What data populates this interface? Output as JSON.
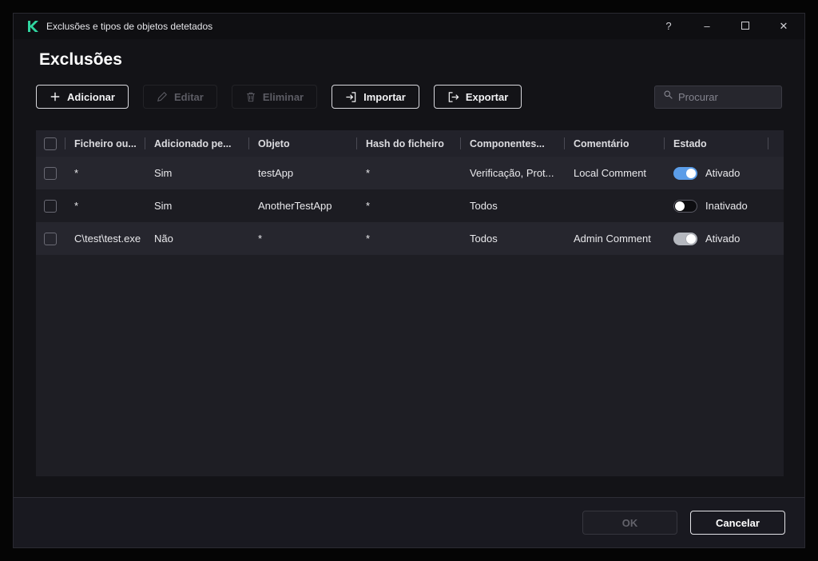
{
  "window": {
    "title": "Exclusões e tipos de objetos detetados",
    "help_glyph": "?",
    "minimize_glyph": "–",
    "close_glyph": "✕"
  },
  "page": {
    "title": "Exclusões"
  },
  "toolbar": {
    "add": "Adicionar",
    "edit": "Editar",
    "delete": "Eliminar",
    "import": "Importar",
    "export": "Exportar",
    "search_placeholder": "Procurar"
  },
  "table": {
    "headers": {
      "file": "Ficheiro ou...",
      "added": "Adicionado pe...",
      "object": "Objeto",
      "hash": "Hash do ficheiro",
      "components": "Componentes...",
      "comment": "Comentário",
      "state": "Estado"
    },
    "rows": [
      {
        "file": "*",
        "added": "Sim",
        "object": "testApp",
        "hash": "*",
        "components": "Verificação, Prot...",
        "comment": "Local Comment",
        "state_label": "Ativado",
        "toggle": "on"
      },
      {
        "file": "*",
        "added": "Sim",
        "object": "AnotherTestApp",
        "hash": "*",
        "components": "Todos",
        "comment": "",
        "state_label": "Inativado",
        "toggle": "off"
      },
      {
        "file": "C\\test\\test.exe",
        "added": "Não",
        "object": "*",
        "hash": "*",
        "components": "Todos",
        "comment": "Admin Comment",
        "state_label": "Ativado",
        "toggle": "on-muted"
      }
    ]
  },
  "footer": {
    "ok": "OK",
    "cancel": "Cancelar"
  },
  "colors": {
    "brand_green": "#30d5a0",
    "toggle_on": "#5b9de8"
  }
}
